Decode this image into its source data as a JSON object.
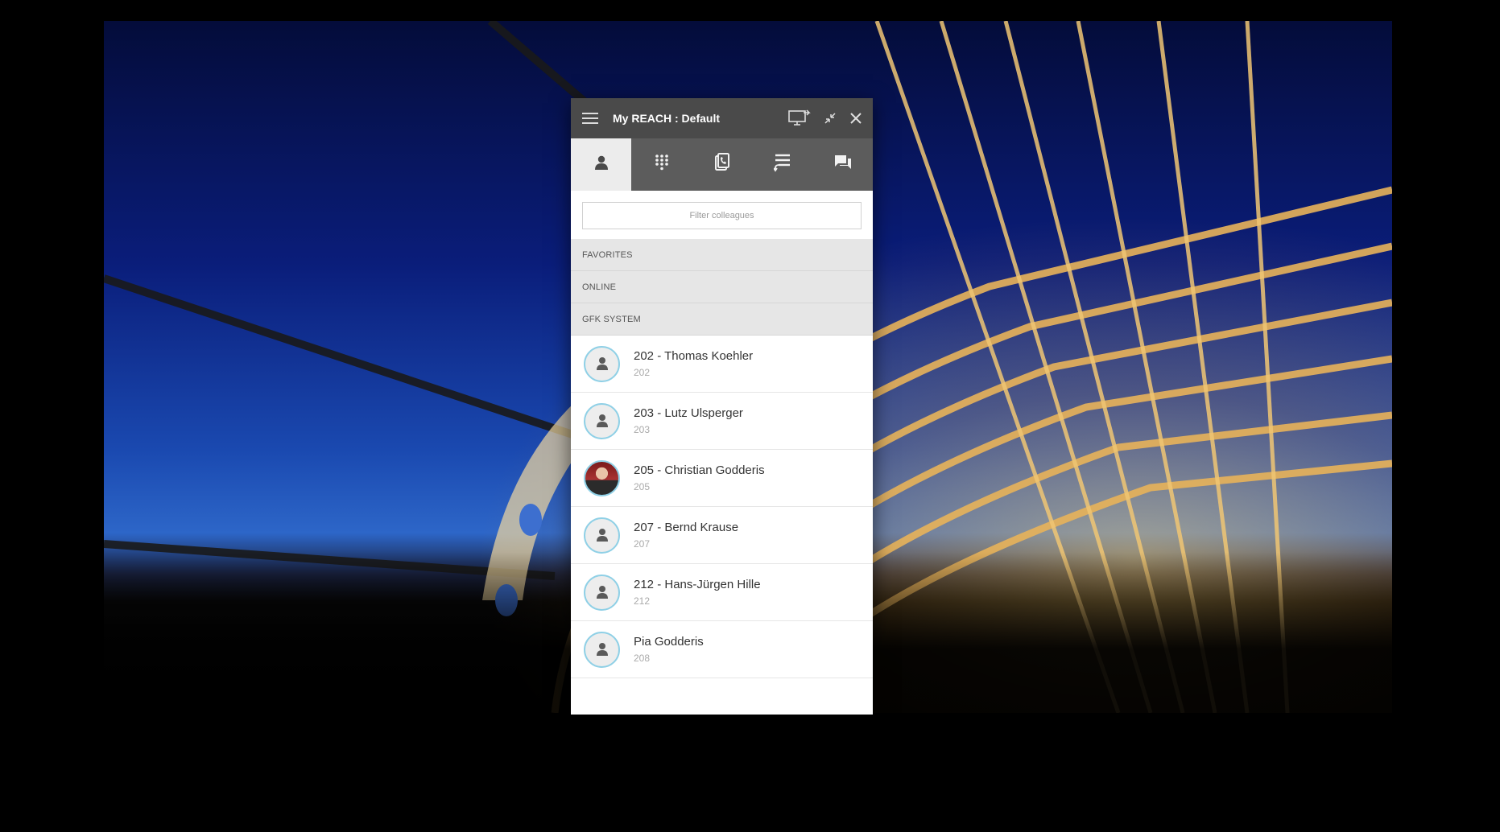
{
  "window": {
    "title": "My REACH : Default"
  },
  "titlebar_icons": [
    "menu-icon",
    "screen-share-icon",
    "collapse-icon",
    "close-icon"
  ],
  "tabs": [
    {
      "name": "contacts",
      "icon": "person-icon",
      "active": true
    },
    {
      "name": "dialpad",
      "icon": "dialpad-icon",
      "active": false
    },
    {
      "name": "call-history",
      "icon": "phone-log-icon",
      "active": false
    },
    {
      "name": "queues",
      "icon": "queue-list-icon",
      "active": false
    },
    {
      "name": "chat",
      "icon": "chat-icon",
      "active": false
    }
  ],
  "filter": {
    "placeholder": "Filter colleagues",
    "value": ""
  },
  "sections": [
    {
      "label": "FAVORITES"
    },
    {
      "label": "ONLINE"
    },
    {
      "label": "GFK SYSTEM"
    }
  ],
  "contacts": [
    {
      "name": "202 - Thomas Koehler",
      "ext": "202",
      "avatar": "default"
    },
    {
      "name": "203 - Lutz Ulsperger",
      "ext": "203",
      "avatar": "default"
    },
    {
      "name": "205 - Christian Godderis",
      "ext": "205",
      "avatar": "photo"
    },
    {
      "name": "207 - Bernd Krause",
      "ext": "207",
      "avatar": "default"
    },
    {
      "name": "212 - Hans-Jürgen Hille",
      "ext": "212",
      "avatar": "default"
    },
    {
      "name": "Pia Godderis",
      "ext": "208",
      "avatar": "default"
    }
  ],
  "colors": {
    "titlebar": "#4a4a4a",
    "tabbar": "#5c5c5c",
    "active_tab": "#ececec",
    "avatar_ring": "#8fd0e6"
  }
}
